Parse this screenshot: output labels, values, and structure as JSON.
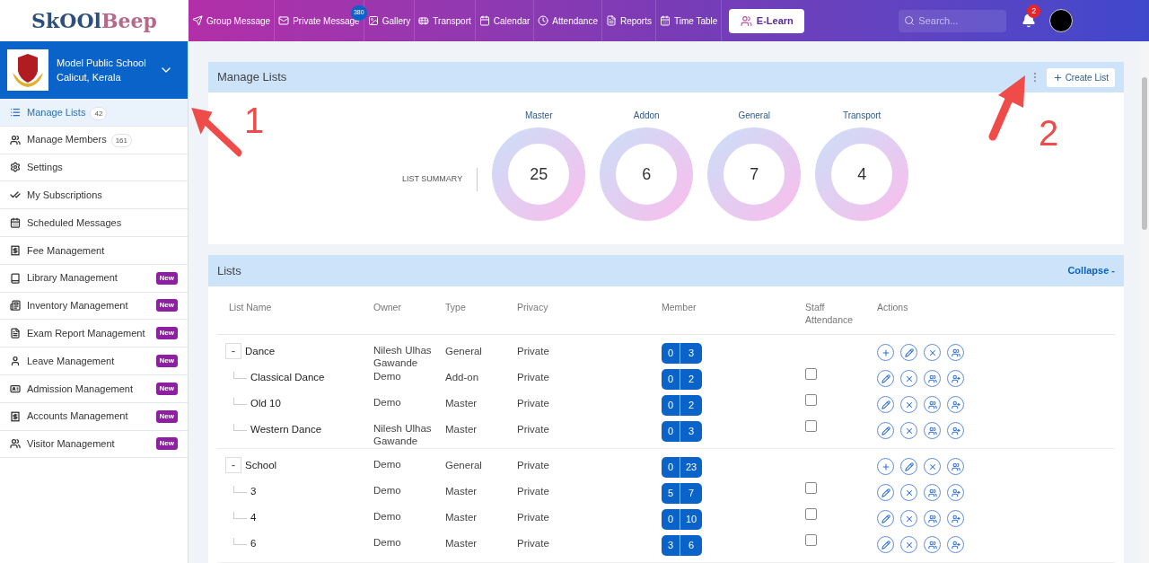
{
  "logo": {
    "first": "SkOOl",
    "second": "Beep"
  },
  "nav": [
    {
      "label": "Group Message"
    },
    {
      "label": "Private Message",
      "badge": "380"
    },
    {
      "label": "Gallery"
    },
    {
      "label": "Transport"
    },
    {
      "label": "Calendar"
    },
    {
      "label": "Attendance"
    },
    {
      "label": "Reports"
    },
    {
      "label": "Time Table"
    }
  ],
  "elearn": "E-Learn",
  "search": {
    "placeholder": "Search..."
  },
  "notifications": "2",
  "school": {
    "name": "Model Public School",
    "place": "Calicut, Kerala"
  },
  "sidebar": [
    {
      "label": "Manage Lists",
      "count": "42",
      "selected": true
    },
    {
      "label": "Manage Members",
      "count": "161",
      "selected": false
    },
    {
      "label": "Settings",
      "selected": false
    },
    {
      "label": "My Subscriptions",
      "selected": false
    },
    {
      "label": "Scheduled Messages",
      "selected": false
    },
    {
      "label": "Fee Management",
      "selected": false
    },
    {
      "label": "Library Management",
      "badge": "New",
      "selected": false
    },
    {
      "label": "Inventory Management",
      "badge": "New",
      "selected": false
    },
    {
      "label": "Exam Report Management",
      "badge": "New",
      "selected": false
    },
    {
      "label": "Leave Management",
      "badge": "New",
      "selected": false
    },
    {
      "label": "Admission Management",
      "badge": "New",
      "selected": false
    },
    {
      "label": "Accounts Management",
      "badge": "New",
      "selected": false
    },
    {
      "label": "Visitor Management",
      "badge": "New",
      "selected": false
    }
  ],
  "manage": {
    "title": "Manage Lists",
    "create": "Create List",
    "summary_label": "LIST SUMMARY",
    "summary": [
      {
        "label": "Master",
        "value": "25"
      },
      {
        "label": "Addon",
        "value": "6"
      },
      {
        "label": "General",
        "value": "7"
      },
      {
        "label": "Transport",
        "value": "4"
      }
    ]
  },
  "lists": {
    "title": "Lists",
    "collapse": "Collapse -",
    "columns": [
      "List Name",
      "Owner",
      "Type",
      "Privacy",
      "Member",
      "Staff Attendance",
      "Actions"
    ],
    "groups": [
      {
        "name": "Dance",
        "owner": "Nilesh Ulhas Gawande",
        "type": "General",
        "privacy": "Private",
        "members": [
          "0",
          "3"
        ],
        "expanded": true,
        "toggle": "-",
        "children": [
          {
            "name": "Classical Dance",
            "owner": "Demo",
            "type": "Add-on",
            "privacy": "Private",
            "members": [
              "0",
              "2"
            ],
            "checked": false
          },
          {
            "name": "Old 10",
            "owner": "Demo",
            "type": "Master",
            "privacy": "Private",
            "members": [
              "0",
              "2"
            ],
            "checked": false
          },
          {
            "name": "Western Dance",
            "owner": "Nilesh Ulhas Gawande",
            "type": "Master",
            "privacy": "Private",
            "members": [
              "0",
              "3"
            ],
            "checked": false
          }
        ]
      },
      {
        "name": "School",
        "owner": "Demo",
        "type": "General",
        "privacy": "Private",
        "members": [
          "0",
          "23"
        ],
        "expanded": true,
        "toggle": "-",
        "children": [
          {
            "name": "3",
            "owner": "Demo",
            "type": "Master",
            "privacy": "Private",
            "members": [
              "5",
              "7"
            ],
            "checked": false
          },
          {
            "name": "4",
            "owner": "Demo",
            "type": "Master",
            "privacy": "Private",
            "members": [
              "0",
              "10"
            ],
            "checked": false
          },
          {
            "name": "6",
            "owner": "Demo",
            "type": "Master",
            "privacy": "Private",
            "members": [
              "3",
              "6"
            ],
            "checked": false
          }
        ]
      }
    ]
  },
  "annotations": [
    {
      "label": "1"
    },
    {
      "label": "2"
    }
  ]
}
